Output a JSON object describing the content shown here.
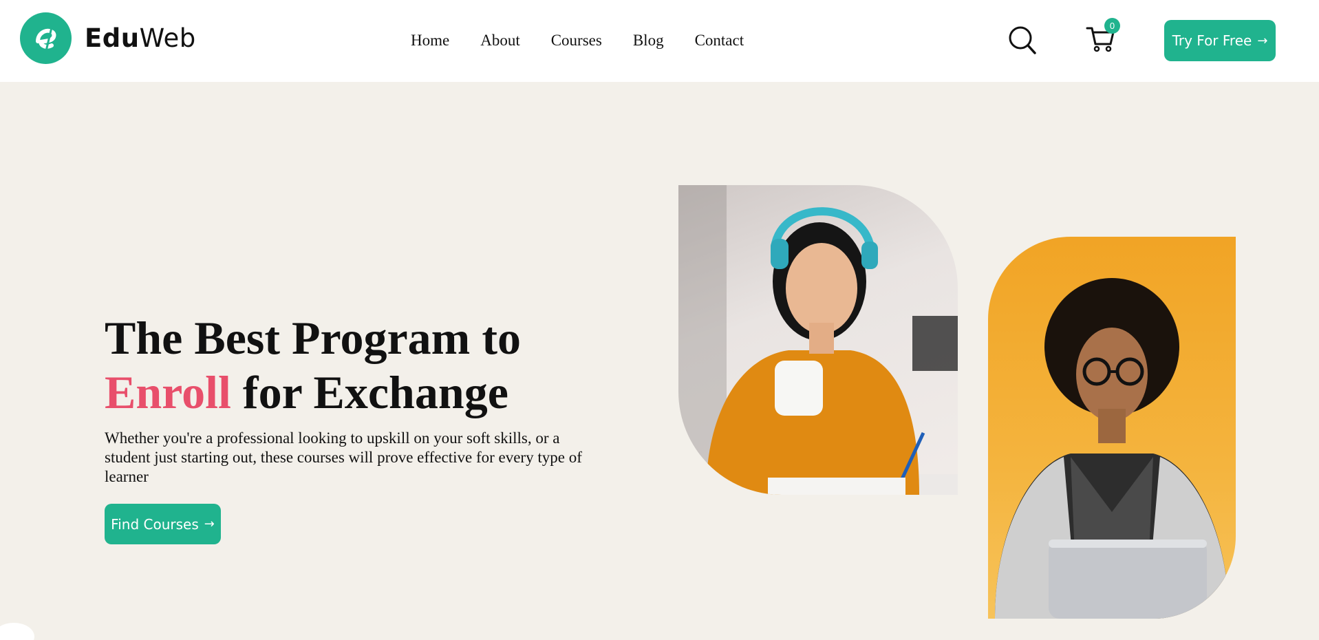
{
  "brand": {
    "name_bold": "Edu",
    "name_light": "Web",
    "logo_letter": "e",
    "accent_color": "#20b38e"
  },
  "nav": {
    "items": [
      {
        "label": "Home"
      },
      {
        "label": "About"
      },
      {
        "label": "Courses"
      },
      {
        "label": "Blog"
      },
      {
        "label": "Contact"
      }
    ]
  },
  "header": {
    "search_icon": "search-icon",
    "cart_icon": "cart-icon",
    "cart_count": "0",
    "cta_label": "Try For Free",
    "cta_arrow": "→"
  },
  "hero": {
    "title_line1": "The Best Program to",
    "title_accent": "Enroll",
    "title_rest": " for Exchange",
    "description": "Whether you're a professional looking to upskill on your soft skills, or a student just starting out, these courses will prove effective for every type of learner",
    "cta_label": "Find Courses",
    "cta_arrow": "→",
    "accent_color": "#e84f6b",
    "background": "#f3f0ea"
  }
}
